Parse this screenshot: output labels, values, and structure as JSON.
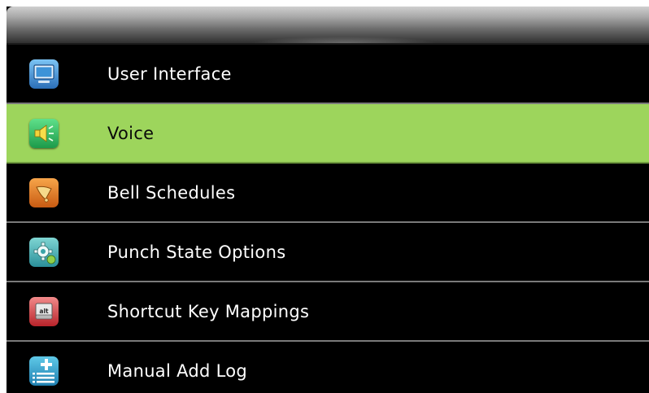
{
  "menu": {
    "items": [
      {
        "label": "User Interface",
        "icon": "monitor-icon",
        "selected": false
      },
      {
        "label": "Voice",
        "icon": "speaker-icon",
        "selected": true
      },
      {
        "label": "Bell Schedules",
        "icon": "bell-icon",
        "selected": false
      },
      {
        "label": "Punch State Options",
        "icon": "gear-icon",
        "selected": false
      },
      {
        "label": "Shortcut Key Mappings",
        "icon": "alt-key-icon",
        "selected": false
      },
      {
        "label": "Manual Add Log",
        "icon": "add-list-icon",
        "selected": false
      }
    ]
  },
  "colors": {
    "selected_row": "#9dd55c",
    "background": "#000000",
    "text": "#ffffff"
  }
}
